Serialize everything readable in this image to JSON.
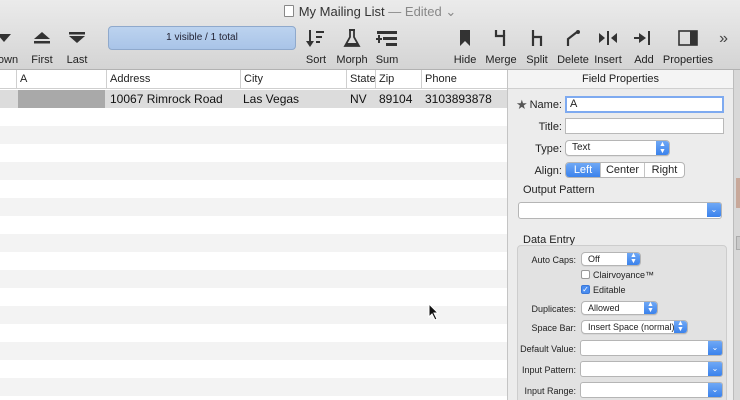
{
  "window": {
    "title": "My Mailing List",
    "edited": "— Edited",
    "edited_chevron": "⌄"
  },
  "toolbar": {
    "status": "1 visible / 1 total",
    "buttons": [
      {
        "label": "Down",
        "icon": "arrow-down-icon"
      },
      {
        "label": "First",
        "icon": "arrow-first-icon"
      },
      {
        "label": "Last",
        "icon": "arrow-last-icon"
      },
      {
        "label": "Sort",
        "icon": "sort-icon"
      },
      {
        "label": "Morph",
        "icon": "flask-icon"
      },
      {
        "label": "Sum",
        "icon": "sum-icon"
      },
      {
        "label": "Hide",
        "icon": "bookmark-icon"
      },
      {
        "label": "Merge",
        "icon": "merge-icon"
      },
      {
        "label": "Split",
        "icon": "split-icon"
      },
      {
        "label": "Delete",
        "icon": "delete-icon"
      },
      {
        "label": "Insert",
        "icon": "insert-icon"
      },
      {
        "label": "Add",
        "icon": "add-icon"
      },
      {
        "label": "Properties",
        "icon": "properties-icon"
      }
    ],
    "more": "»"
  },
  "table": {
    "columns": [
      "A",
      "Address",
      "City",
      "State",
      "Zip",
      "Phone"
    ],
    "rows": [
      [
        "",
        "10067 Rimrock Road",
        "Las Vegas",
        "NV",
        "89104",
        "3103893878"
      ]
    ]
  },
  "panel": {
    "title": "Field Properties",
    "name_label": "Name:",
    "name_value": "A",
    "title_label": "Title:",
    "title_value": "",
    "type_label": "Type:",
    "type_value": "Text",
    "align_label": "Align:",
    "align_options": [
      "Left",
      "Center",
      "Right"
    ],
    "align_selected": "Left",
    "output_pattern_label": "Output Pattern",
    "data_entry_label": "Data Entry",
    "auto_caps_label": "Auto Caps:",
    "auto_caps_value": "Off",
    "clairvoyance_label": "Clairvoyance™",
    "clairvoyance_checked": false,
    "editable_label": "Editable",
    "editable_checked": true,
    "duplicates_label": "Duplicates:",
    "duplicates_value": "Allowed",
    "space_bar_label": "Space Bar:",
    "space_bar_value": "Insert Space (normal)",
    "default_value_label": "Default Value:",
    "input_pattern_label": "Input Pattern:",
    "input_range_label": "Input Range:"
  },
  "colors": {
    "accent": "#3b82ec",
    "status_box": "#a9c4e8",
    "selected_row": "#dcdcdc"
  }
}
